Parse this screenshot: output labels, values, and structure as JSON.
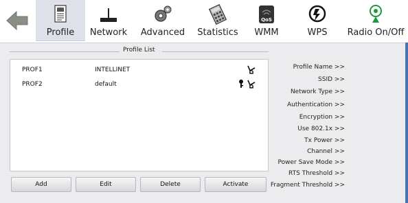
{
  "toolbar": {
    "items": [
      {
        "label": "Profile",
        "icon": "profile-icon"
      },
      {
        "label": "Network",
        "icon": "network-icon"
      },
      {
        "label": "Advanced",
        "icon": "gear-icon"
      },
      {
        "label": "Statistics",
        "icon": "calculator-icon"
      },
      {
        "label": "WMM",
        "icon": "qos-icon",
        "badge": "QoS"
      },
      {
        "label": "WPS",
        "icon": "wps-icon"
      },
      {
        "label": "Radio On/Off",
        "icon": "radio-icon"
      }
    ],
    "back_icon": "back-arrow-icon"
  },
  "profile_list": {
    "title": "Profile List",
    "rows": [
      {
        "name": "PROF1",
        "ssid": "INTELLINET",
        "icons": [
          "wireless-signal-icon"
        ]
      },
      {
        "name": "PROF2",
        "ssid": "default",
        "icons": [
          "key-icon",
          "wireless-signal-icon"
        ]
      }
    ]
  },
  "buttons": {
    "add": "Add",
    "edit": "Edit",
    "delete": "Delete",
    "activate": "Activate"
  },
  "details": [
    "Profile Name >>",
    "SSID >>",
    "Network Type >>",
    "Authentication >>",
    "Encryption >>",
    "Use 802.1x >>",
    "Tx Power >>",
    "Channel >>",
    "Power Save Mode >>",
    "RTS Threshold >>",
    "Fragment Threshold >>"
  ],
  "colors": {
    "accent": "#4a72b8",
    "panel_bg": "#ececee",
    "active_tab_bg": "#dfe1ea"
  }
}
